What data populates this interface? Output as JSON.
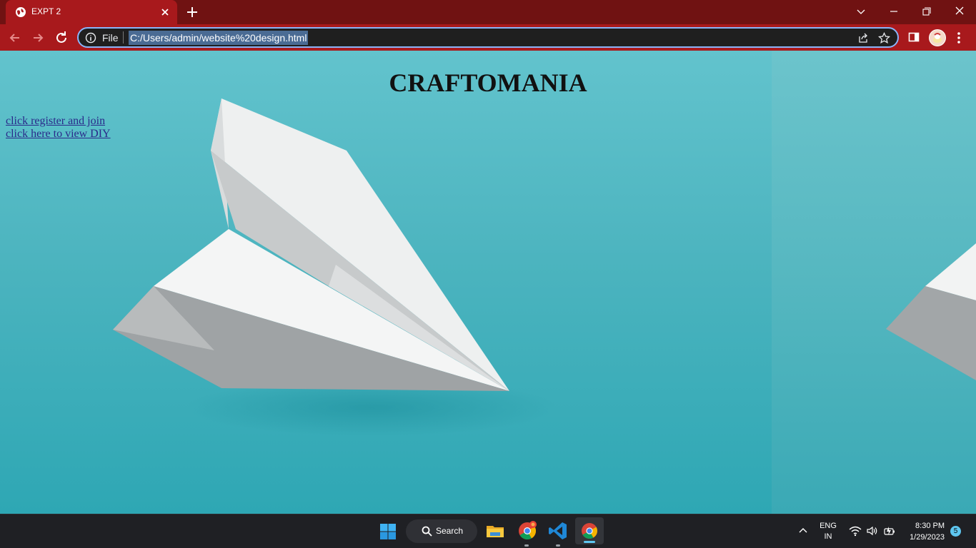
{
  "browser": {
    "tab_title": "EXPT 2",
    "scheme_label": "File",
    "url": "C:/Users/admin/website%20design.html",
    "accent_color": "#a8191c"
  },
  "page": {
    "heading": "CRAFTOMANIA",
    "links": [
      {
        "label": "click register and join"
      },
      {
        "label": "click here to view DIY"
      }
    ],
    "background_image": "paper-airplane-on-teal"
  },
  "taskbar": {
    "search_label": "Search",
    "apps": [
      "file-explorer-icon",
      "chrome-notification-icon",
      "vscode-icon",
      "chrome-icon"
    ],
    "lang_line1": "ENG",
    "lang_line2": "IN",
    "time": "8:30 PM",
    "date": "1/29/2023",
    "notification_count": "5"
  }
}
